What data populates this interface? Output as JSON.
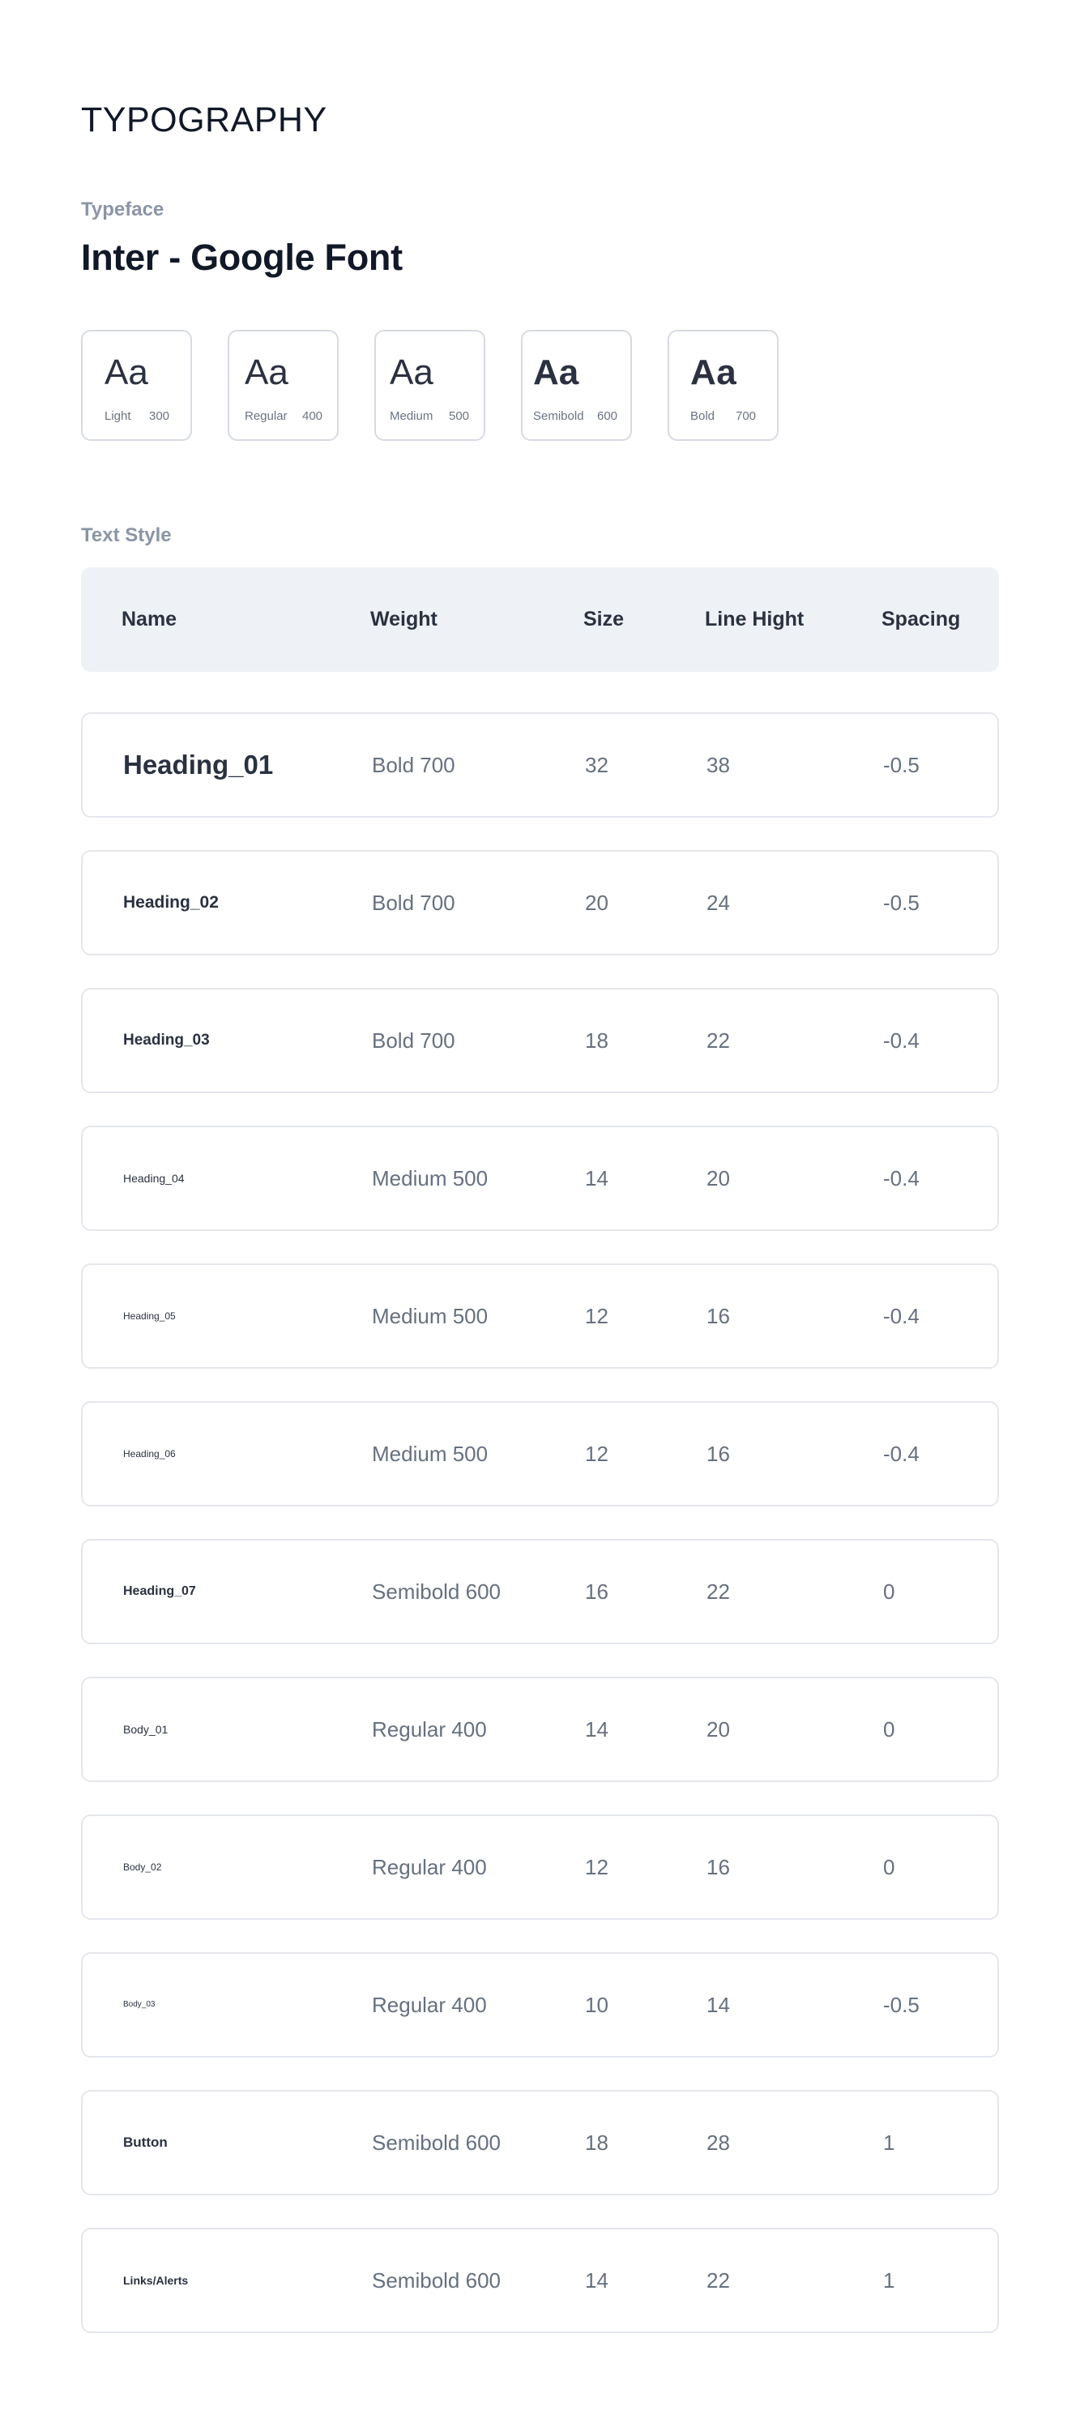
{
  "page_title": "TYPOGRAPHY",
  "typeface": {
    "label": "Typeface",
    "font_name": "Inter - Google Font",
    "weights": [
      {
        "sample": "Aa",
        "name": "Light",
        "value": "300"
      },
      {
        "sample": "Aa",
        "name": "Regular",
        "value": "400"
      },
      {
        "sample": "Aa",
        "name": "Medium",
        "value": "500"
      },
      {
        "sample": "Aa",
        "name": "Semibold",
        "value": "600"
      },
      {
        "sample": "Aa",
        "name": "Bold",
        "value": "700"
      }
    ]
  },
  "text_style": {
    "label": "Text Style",
    "headers": {
      "name": "Name",
      "weight": "Weight",
      "size": "Size",
      "line_height": "Line Hight",
      "spacing": "Spacing"
    },
    "rows": [
      {
        "name": "Heading_01",
        "weight": "Bold 700",
        "size": "32",
        "line_height": "38",
        "spacing": "-0.5"
      },
      {
        "name": "Heading_02",
        "weight": "Bold 700",
        "size": "20",
        "line_height": "24",
        "spacing": "-0.5"
      },
      {
        "name": "Heading_03",
        "weight": "Bold 700",
        "size": "18",
        "line_height": "22",
        "spacing": "-0.4"
      },
      {
        "name": "Heading_04",
        "weight": "Medium 500",
        "size": "14",
        "line_height": "20",
        "spacing": "-0.4"
      },
      {
        "name": "Heading_05",
        "weight": "Medium 500",
        "size": "12",
        "line_height": "16",
        "spacing": "-0.4"
      },
      {
        "name": "Heading_06",
        "weight": "Medium 500",
        "size": "12",
        "line_height": "16",
        "spacing": "-0.4"
      },
      {
        "name": "Heading_07",
        "weight": "Semibold 600",
        "size": "16",
        "line_height": "22",
        "spacing": "0"
      },
      {
        "name": "Body_01",
        "weight": "Regular 400",
        "size": "14",
        "line_height": "20",
        "spacing": "0"
      },
      {
        "name": "Body_02",
        "weight": "Regular 400",
        "size": "12",
        "line_height": "16",
        "spacing": "0"
      },
      {
        "name": "Body_03",
        "weight": "Regular 400",
        "size": "10",
        "line_height": "14",
        "spacing": "-0.5"
      },
      {
        "name": "Button",
        "weight": "Semibold 600",
        "size": "18",
        "line_height": "28",
        "spacing": "1"
      },
      {
        "name": "Links/Alerts",
        "weight": "Semibold 600",
        "size": "14",
        "line_height": "22",
        "spacing": "1"
      }
    ]
  }
}
